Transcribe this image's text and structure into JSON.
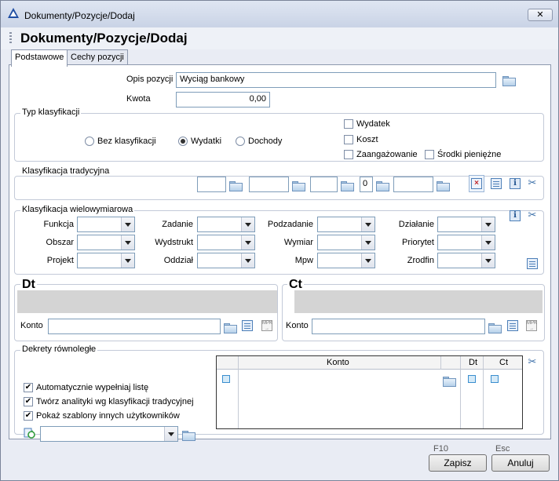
{
  "window": {
    "title": "Dokumenty/Pozycje/Dodaj",
    "close_label": "✕"
  },
  "page_title": "Dokumenty/Pozycje/Dodaj",
  "tabs": [
    {
      "label": "Podstawowe",
      "active": true
    },
    {
      "label": "Cechy pozycji",
      "active": false
    }
  ],
  "fields": {
    "opis_label": "Opis pozycji",
    "opis_value": "Wyciąg bankowy",
    "kwota_label": "Kwota",
    "kwota_value": "0,00"
  },
  "typ_klasyfikacji": {
    "title": "Typ klasyfikacji",
    "radios": [
      {
        "label": "Bez klasyfikacji",
        "selected": false
      },
      {
        "label": "Wydatki",
        "selected": true
      },
      {
        "label": "Dochody",
        "selected": false
      }
    ],
    "checkboxes": [
      {
        "label": "Wydatek",
        "checked": false
      },
      {
        "label": "Koszt",
        "checked": false
      },
      {
        "label": "Zaangażowanie",
        "checked": false
      },
      {
        "label": "Środki pieniężne",
        "checked": false
      }
    ]
  },
  "klasyfikacja_tradycyjna": {
    "title": "Klasyfikacja tradycyjna",
    "paragraf_value": "0"
  },
  "klasyfikacja_wielowymiarowa": {
    "title": "Klasyfikacja wielowymiarowa",
    "fields": [
      "Funkcja",
      "Zadanie",
      "Podzadanie",
      "Działanie",
      "Obszar",
      "Wydstrukt",
      "Wymiar",
      "Priorytet",
      "Projekt",
      "Oddział",
      "Mpw",
      "Zrodfin"
    ]
  },
  "dt": {
    "title": "Dt",
    "konto_label": "Konto",
    "konto_value": ""
  },
  "ct": {
    "title": "Ct",
    "konto_label": "Konto",
    "konto_value": ""
  },
  "dekrety": {
    "title": "Dekrety równoległe",
    "columns": {
      "konto": "Konto",
      "dt": "Dt",
      "ct": "Ct"
    },
    "options": [
      {
        "label": "Automatycznie wypełniaj listę",
        "checked": true
      },
      {
        "label": "Twórz analityki wg klasyfikacji tradycyjnej",
        "checked": true
      },
      {
        "label": "Pokaż szablony innych użytkowników",
        "checked": true
      }
    ],
    "template_value": ""
  },
  "buttons": {
    "save": {
      "label": "Zapisz",
      "hotkey": "F10"
    },
    "cancel": {
      "label": "Anuluj",
      "hotkey": "Esc"
    }
  },
  "icons": {
    "folder": "folder-icon",
    "scissors": "scissors-icon",
    "info": "info-icon",
    "list": "list-icon",
    "mpk": "mpk-icon"
  },
  "colors": {
    "title_bar": "#c9d3e6",
    "panel_border": "#8d98ae",
    "gray_band": "#d4d4d4",
    "icon_blue": "#3a8ecf"
  }
}
